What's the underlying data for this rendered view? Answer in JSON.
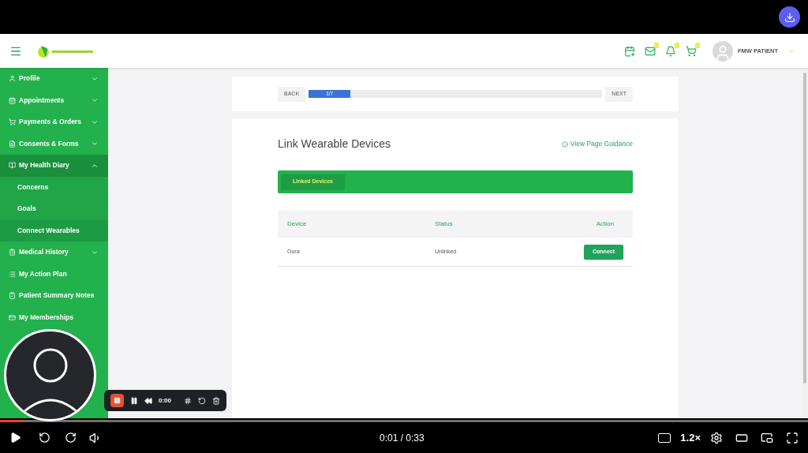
{
  "header": {
    "user_name": "FMW PATIENT"
  },
  "sidebar": {
    "items": [
      {
        "label": "Profile",
        "expanded": false
      },
      {
        "label": "Appointments",
        "expanded": false
      },
      {
        "label": "Payments & Orders",
        "expanded": false
      },
      {
        "label": "Consents & Forms",
        "expanded": false
      },
      {
        "label": "My Health Diary",
        "expanded": true,
        "children": [
          {
            "label": "Concerns",
            "selected": false
          },
          {
            "label": "Goals",
            "selected": false
          },
          {
            "label": "Connect Wearables",
            "selected": true
          }
        ]
      },
      {
        "label": "Medical History",
        "expanded": false
      },
      {
        "label": "My Action Plan"
      },
      {
        "label": "Patient Summary Notes"
      },
      {
        "label": "My Memberships"
      }
    ]
  },
  "stepper": {
    "back": "BACK",
    "next": "NEXT",
    "progress_label": "1/7",
    "level": 0.143
  },
  "page": {
    "title": "Link Wearable Devices",
    "guidance_link": "View Page Guidance",
    "tabs": [
      {
        "label": "Linked Devices",
        "selected": true
      }
    ],
    "table": {
      "columns": [
        "Device",
        "Status",
        "Action"
      ],
      "rows": [
        {
          "device": "Oura",
          "status": "Unlinked",
          "action": "Connect"
        }
      ]
    }
  },
  "recorder": {
    "time": "0:00"
  },
  "player": {
    "time": "0:01 / 0:33",
    "speed": "1.2×",
    "level": 0.03
  }
}
